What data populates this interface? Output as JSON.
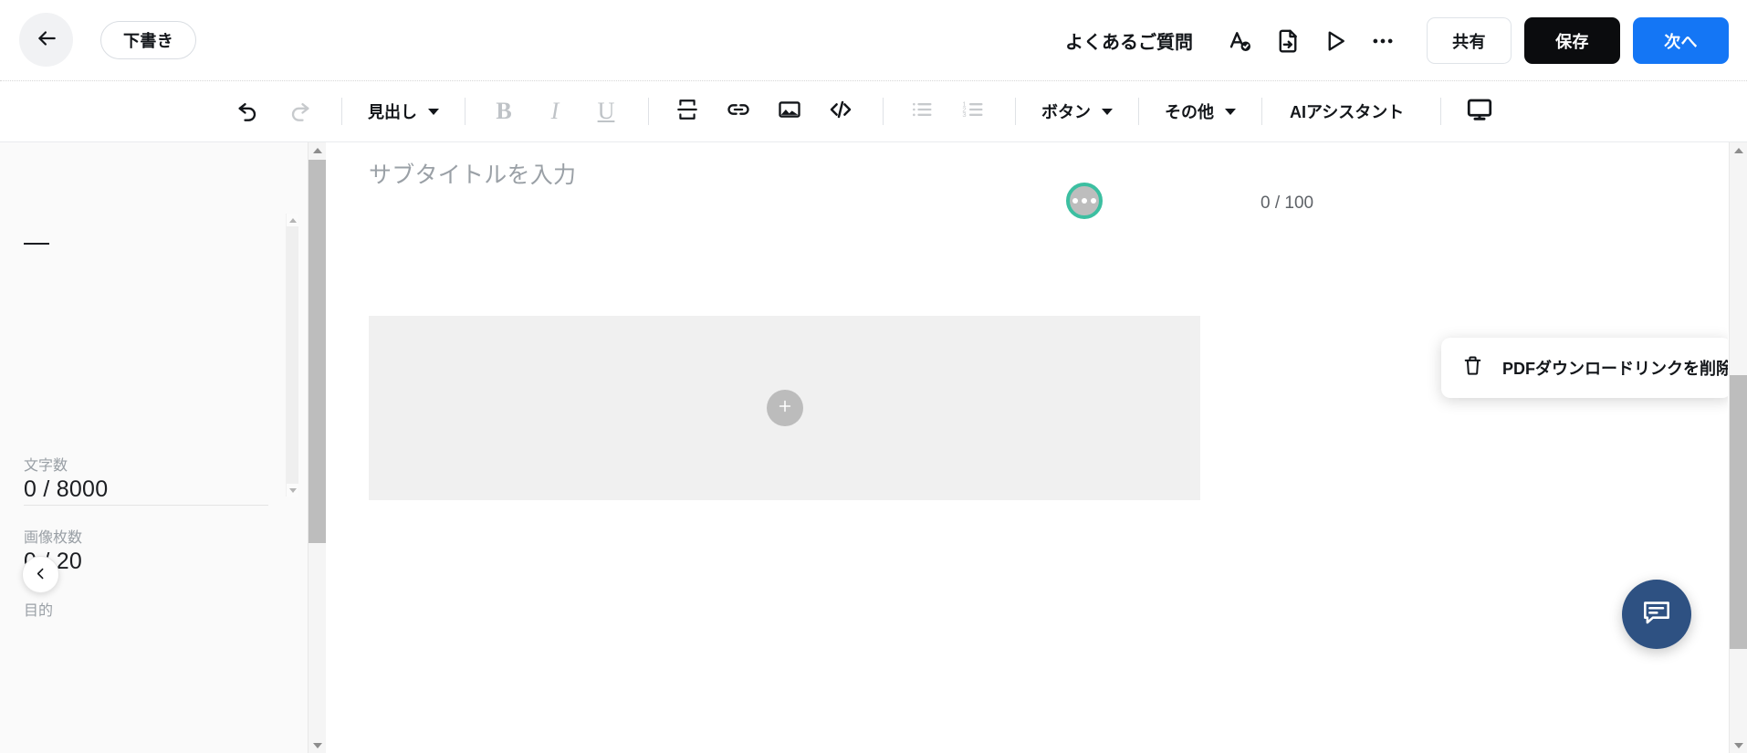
{
  "header": {
    "back_icon": "arrow-left-icon",
    "status_chip": "下書き",
    "faq_link": "よくあるご質問",
    "icons": [
      {
        "name": "spellcheck-icon",
        "label": "スペルチェック"
      },
      {
        "name": "file-export-icon",
        "label": "エクスポート"
      },
      {
        "name": "play-icon",
        "label": "プレビュー再生"
      },
      {
        "name": "more-horizontal-icon",
        "label": "その他の操作"
      }
    ],
    "share_label": "共有",
    "save_label": "保存",
    "next_label": "次へ",
    "accent_blue": "#1476f5",
    "save_black": "#0b0c0e"
  },
  "toolbar": {
    "undo_icon": "undo-icon",
    "redo_icon": "redo-icon",
    "heading_label": "見出し",
    "bold_label": "B",
    "italic_label": "I",
    "underline_label": "U",
    "divider_icon": "section-divider-icon",
    "link_icon": "link-icon",
    "image_icon": "image-icon",
    "code_icon": "code-icon",
    "bullet_list_icon": "bullet-list-icon",
    "numbered_list_icon": "numbered-list-icon",
    "button_label": "ボタン",
    "other_label": "その他",
    "ai_assistant_label": "AIアシスタント",
    "preview_icon": "monitor-icon"
  },
  "sidebar": {
    "stats": [
      {
        "label": "文字数",
        "value": "0 / 8000"
      },
      {
        "label": "画像枚数",
        "value": "0 / 20"
      }
    ],
    "purpose_label": "目的",
    "collapse_icon": "chevron-left-icon"
  },
  "canvas": {
    "subtitle_placeholder": "サブタイトルを入力",
    "subtitle_value": "",
    "char_counter": "0 / 100",
    "add_icon": "plus-icon",
    "more_icon": "more-horizontal-icon",
    "highlight_color": "#3cbfa1"
  },
  "context_menu": {
    "trash_icon": "trash-icon",
    "item_label": "PDFダウンロードリンクを削除"
  },
  "chat": {
    "icon": "chat-bubble-icon",
    "color": "#2e5182"
  }
}
